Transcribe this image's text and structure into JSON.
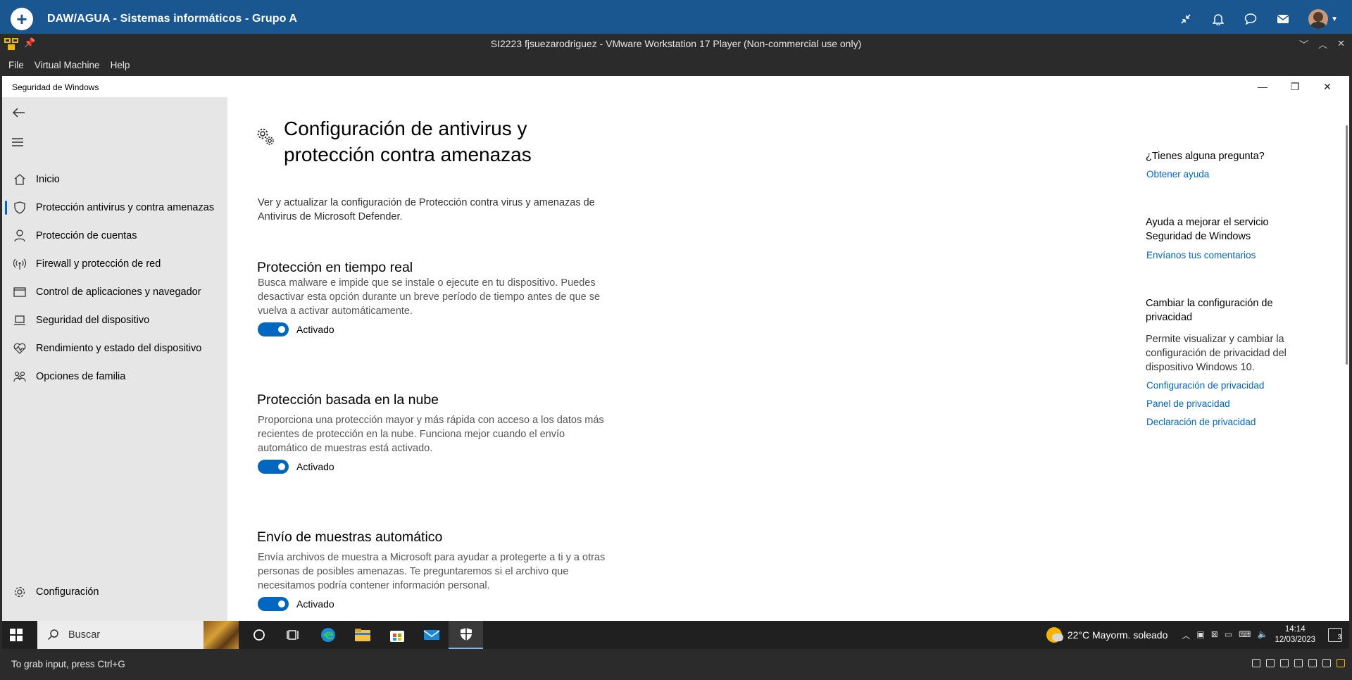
{
  "topbar": {
    "title": "DAW/AGUA - Sistemas informáticos - Grupo A",
    "icons": [
      "plus-icon",
      "collapse-icon",
      "bell-icon",
      "chat-icon",
      "mail-icon",
      "avatar"
    ]
  },
  "vmware": {
    "title": "SI2223 fjsuezarodriguez - VMware Workstation 17 Player (Non-commercial use only)",
    "menu": [
      "File",
      "Virtual Machine",
      "Help"
    ]
  },
  "window": {
    "title": "Seguridad de Windows"
  },
  "sidebar": {
    "items": [
      {
        "label": "Inicio",
        "icon": "home-icon"
      },
      {
        "label": "Protección antivirus y contra amenazas",
        "icon": "shield-icon",
        "active": true
      },
      {
        "label": "Protección de cuentas",
        "icon": "person-icon"
      },
      {
        "label": "Firewall y protección de red",
        "icon": "antenna-icon"
      },
      {
        "label": "Control de aplicaciones y navegador",
        "icon": "browser-icon"
      },
      {
        "label": "Seguridad del dispositivo",
        "icon": "laptop-icon"
      },
      {
        "label": "Rendimiento y estado del dispositivo",
        "icon": "heart-icon"
      },
      {
        "label": "Opciones de familia",
        "icon": "family-icon"
      }
    ],
    "settings_label": "Configuración"
  },
  "main": {
    "title": "Configuración de antivirus y protección contra amenazas",
    "description": "Ver y actualizar la configuración de Protección contra virus y amenazas de Antivirus de Microsoft Defender.",
    "sections": [
      {
        "heading": "Protección en tiempo real",
        "text": "Busca malware e impide que se instale o ejecute en tu dispositivo. Puedes desactivar esta opción durante un breve período de tiempo antes de que se vuelva a activar automáticamente.",
        "toggle": "Activado",
        "on": true
      },
      {
        "heading": "Protección basada en la nube",
        "text": "Proporciona una protección mayor y más rápida con acceso a los datos más recientes de protección en la nube. Funciona mejor cuando el envío automático de muestras está activado.",
        "toggle": "Activado",
        "on": true
      },
      {
        "heading": "Envío de muestras automático",
        "text": "Envía archivos de muestra a Microsoft para ayudar a protegerte a ti y a otras personas de posibles amenazas. Te preguntaremos si el archivo que necesitamos podría contener información personal.",
        "toggle": "Activado",
        "on": true
      }
    ]
  },
  "aside": {
    "q_heading": "¿Tienes alguna pregunta?",
    "q_link": "Obtener ayuda",
    "improve_heading": "Ayuda a mejorar el servicio Seguridad de Windows",
    "improve_link": "Envíanos tus comentarios",
    "privacy_heading": "Cambiar la configuración de privacidad",
    "privacy_text": "Permite visualizar y cambiar la configuración de privacidad del dispositivo Windows 10.",
    "privacy_links": [
      "Configuración de privacidad",
      "Panel de privacidad",
      "Declaración de privacidad"
    ]
  },
  "taskbar": {
    "search_placeholder": "Buscar",
    "weather": "22°C  Mayorm. soleado",
    "time": "14:14",
    "date": "12/03/2023",
    "notifications": "3",
    "apps": [
      "cortana-icon",
      "task-view-icon",
      "edge-icon",
      "file-explorer-icon",
      "store-icon",
      "mail-icon",
      "windows-security-icon"
    ]
  },
  "status": {
    "message": "To grab input, press Ctrl+G"
  },
  "colors": {
    "accent": "#0067c0",
    "topbar": "#1a5790",
    "sidebar": "#e6e6e6"
  }
}
